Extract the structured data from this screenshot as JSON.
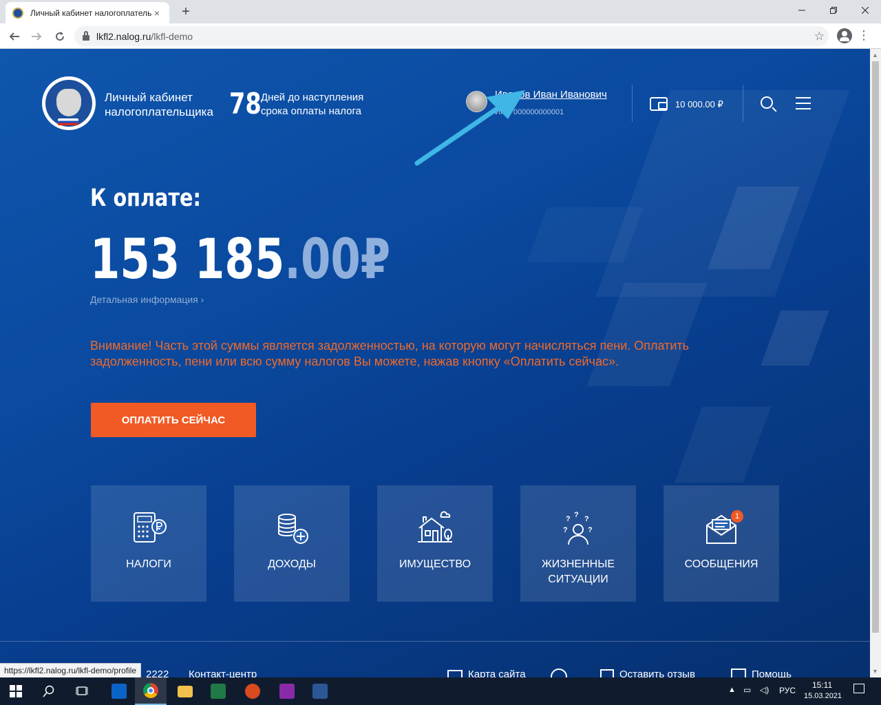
{
  "browser": {
    "tab_title": "Личный кабинет налогоплатель",
    "tab_close": "×",
    "new_tab": "+",
    "url_host": "lkfl2.nalog.ru",
    "url_path": "/lkfl-demo",
    "status_url": "https://lkfl2.nalog.ru/lkfl-demo/profile"
  },
  "header": {
    "brand_line1": "Личный кабинет",
    "brand_line2": "налогоплательщика",
    "days_count": "78",
    "days_line1": "Дней до наступления",
    "days_line2": "срока оплаты налога",
    "user_name": "Иванов Иван Иванович",
    "user_inn": "ИНН 000000000001",
    "balance": "10 000.00 ₽"
  },
  "payment": {
    "title": "К оплате:",
    "amount_integer": "153 185",
    "amount_decimal": ".00₽",
    "details_link": "Детальная информация ›",
    "warning": "Внимание! Часть этой суммы является задолженностью, на которую могут начисляться пени. Оплатить задолженность, пени или всю сумму налогов Вы можете, нажав кнопку «Оплатить сейчас».",
    "pay_button": "ОПЛАТИТЬ СЕЙЧАС"
  },
  "tiles": [
    {
      "label": "НАЛОГИ",
      "icon": "calculator-ruble-icon"
    },
    {
      "label": "ДОХОДЫ",
      "icon": "coins-plus-icon"
    },
    {
      "label": "ИМУЩЕСТВО",
      "icon": "house-icon"
    },
    {
      "label": "ЖИЗНЕННЫЕ\nСИТУАЦИИ",
      "icon": "person-questions-icon"
    },
    {
      "label": "СООБЩЕНИЯ",
      "icon": "envelope-icon",
      "badge": "1"
    }
  ],
  "footer": {
    "phone_fragment": "2222",
    "contact": "Контакт-центр",
    "sitemap": "Карта сайта",
    "feedback": "Оставить отзыв",
    "help": "Помощь"
  },
  "taskbar": {
    "language": "РУС",
    "time": "15:11",
    "date": "15.03.2021"
  },
  "colors": {
    "accent_orange": "#f15a24",
    "page_blue": "#0c4fa6",
    "warning_text": "#f06a2a",
    "arrow": "#3fb6e6"
  }
}
